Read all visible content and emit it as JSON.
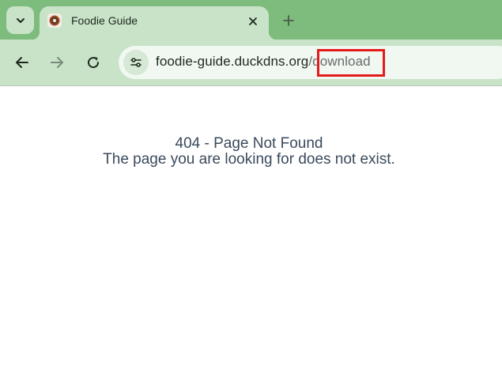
{
  "tab": {
    "title": "Foodie Guide",
    "favicon": "donut-icon"
  },
  "toolbar": {
    "back_icon": "arrow-left-icon",
    "forward_icon": "arrow-right-icon",
    "reload_icon": "reload-icon",
    "site_info_icon": "tune-icon"
  },
  "address_bar": {
    "host": "foodie-guide.duckdns.org",
    "path": "/download"
  },
  "page": {
    "title": "404 - Page Not Found",
    "message": "The page you are looking for does not exist."
  },
  "colors": {
    "tabstrip": "#7ebc7e",
    "toolbar": "#c8e3c8",
    "highlight": "#e31b1b",
    "text": "#3a4a5c"
  }
}
